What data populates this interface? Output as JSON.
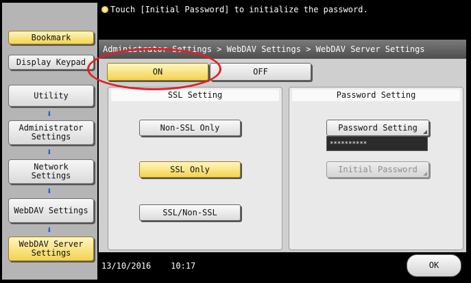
{
  "top_message": "Touch [Initial Password] to initialize the password.",
  "sidebar": {
    "bookmark": "Bookmark",
    "display_keypad": "Display Keypad",
    "nav": [
      "Utility",
      "Administrator\nSettings",
      "Network\nSettings",
      "WebDAV Settings",
      "WebDAV Server\nSettings"
    ]
  },
  "breadcrumb": "Administrator Settings > WebDAV Settings > WebDAV Server Settings",
  "toggle": {
    "on": "ON",
    "off": "OFF",
    "selected": "ON"
  },
  "ssl": {
    "heading": "SSL Setting",
    "options": [
      "Non-SSL Only",
      "SSL Only",
      "SSL/Non-SSL"
    ],
    "selected": "SSL Only"
  },
  "password": {
    "heading": "Password Setting",
    "button": "Password Setting",
    "masked": "**********",
    "initial_button": "Initial Password"
  },
  "status": {
    "date": "13/10/2016",
    "time": "10:17"
  },
  "ok": "OK",
  "colors": {
    "selected": "#f3d350",
    "highlight_ellipse": "#e41e26",
    "arrow": "#1a54d6"
  }
}
